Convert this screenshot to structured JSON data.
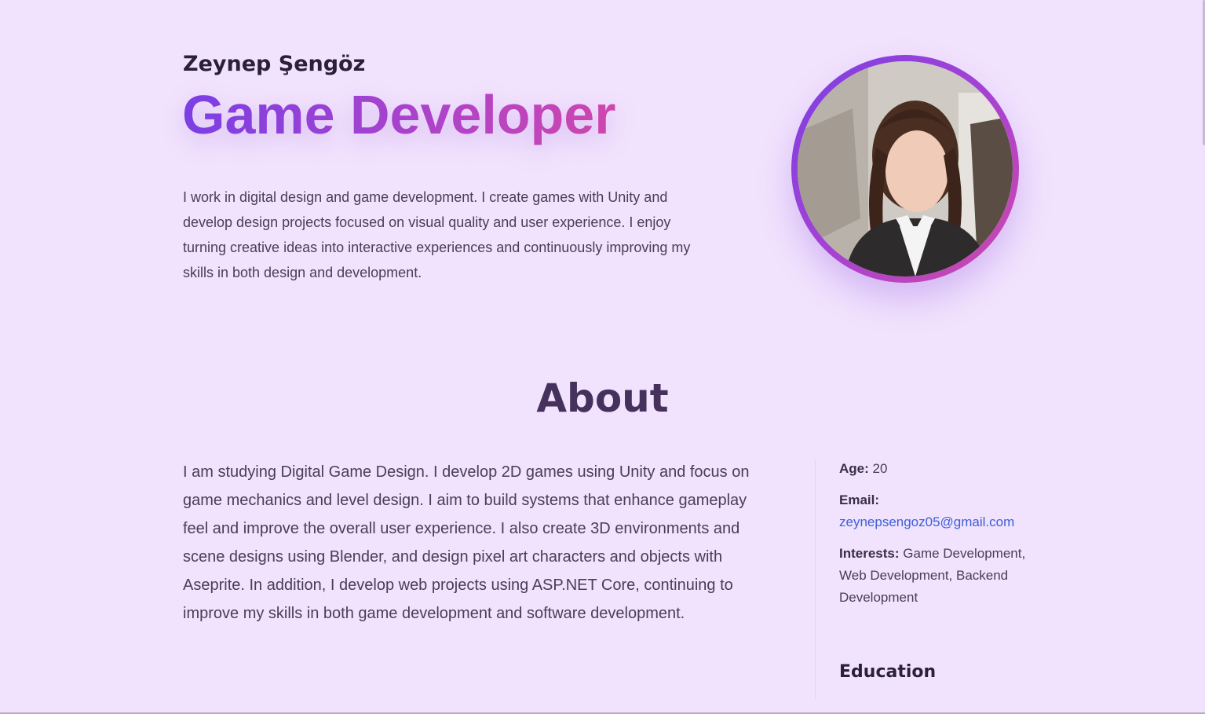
{
  "hero": {
    "name": "Zeynep Şengöz",
    "role": "Game Developer",
    "intro": "I work in digital design and game development. I create games with Unity and develop design projects focused on visual quality and user experience. I enjoy turning creative ideas into interactive experiences and continuously improving my skills in both design and development."
  },
  "about": {
    "title": "About",
    "text": "I am studying Digital Game Design. I develop 2D games using Unity and focus on game mechanics and level design. I aim to build systems that enhance gameplay feel and improve the overall user experience. I also create 3D environments and scene designs using Blender, and design pixel art characters and objects with Aseprite. In addition, I develop web projects using ASP.NET Core, continuing to improve my skills in both game development and software development.",
    "age_label": "Age:",
    "age_value": "20",
    "email_label": "Email:",
    "email_value": "zeynepsengoz05@gmail.com",
    "interests_label": "Interests:",
    "interests_value": "Game Development, Web Development, Backend Development",
    "education_title": "Education"
  },
  "colors": {
    "background": "#f1e2fd",
    "gradient_start": "#7b3fe4",
    "gradient_end": "#cf46ad",
    "heading": "#45315c",
    "link": "#3b5fd9"
  },
  "icons": {
    "profile_photo": "profile-photo"
  }
}
